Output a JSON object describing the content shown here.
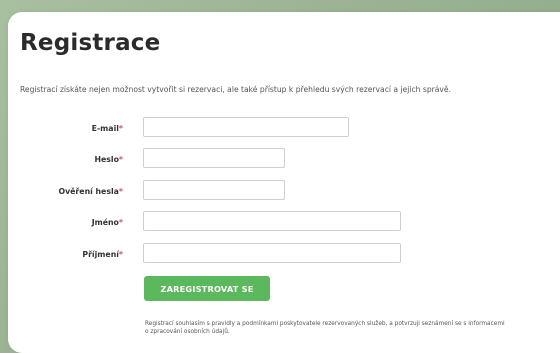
{
  "page": {
    "title": "Registrace",
    "intro": "Registrací získáte nejen možnost vytvořit si rezervaci, ale také přístup k přehledu svých rezervací a jejich správě."
  },
  "form": {
    "required_mark": "*",
    "fields": [
      {
        "label": "E-mail",
        "value": ""
      },
      {
        "label": "Heslo",
        "value": ""
      },
      {
        "label": "Ověření hesla",
        "value": ""
      },
      {
        "label": "Jméno",
        "value": ""
      },
      {
        "label": "Příjmení",
        "value": ""
      }
    ],
    "submit_label": "ZAREGISTROVAT SE",
    "consent": "Registrací souhlasím s pravidly a podmínkami poskytovatele rezervovaných služeb, a potvrzuji seznámení se s informacemi o zpracování osobních údajů."
  },
  "colors": {
    "background": "#9bb393",
    "button": "#5cb85c",
    "required": "#d9534f"
  }
}
